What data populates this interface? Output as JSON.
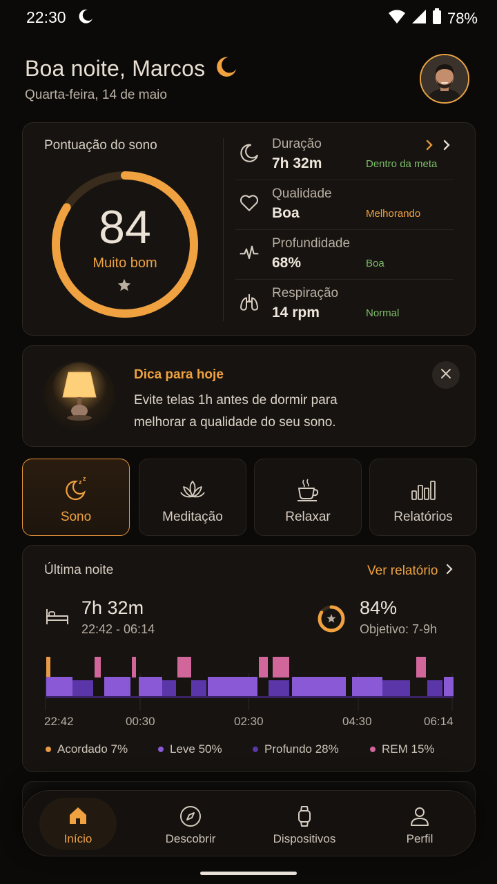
{
  "status_bar": {
    "time": "22:30",
    "battery": "78%"
  },
  "header": {
    "greeting": "Boa noite, Marcos",
    "date": "Quarta-feira, 14 de maio"
  },
  "score": {
    "title": "Pontuação do sono",
    "value": "84",
    "value_fraction": 0.84,
    "label": "Muito bom",
    "metrics": [
      {
        "label": "Duração",
        "value": "7h 32m",
        "status": "Dentro da meta",
        "status_color": "#7fbf6a",
        "icon": "moon-icon"
      },
      {
        "label": "Qualidade",
        "value": "Boa",
        "status": "Melhorando",
        "status_color": "#f0a241",
        "icon": "heart-icon"
      },
      {
        "label": "Profundidade",
        "value": "68%",
        "status": "Boa",
        "status_color": "#7fbf6a",
        "icon": "pulse-icon"
      },
      {
        "label": "Respiração",
        "value": "14 rpm",
        "status": "Normal",
        "status_color": "#7fbf6a",
        "icon": "lungs-icon"
      }
    ]
  },
  "tip": {
    "title": "Dica para hoje",
    "text": "Evite telas 1h antes de dormir para melhorar a qualidade do seu sono."
  },
  "tabs": [
    {
      "label": "Sono",
      "icon": "sleep-moon-icon",
      "active": true
    },
    {
      "label": "Meditação",
      "icon": "lotus-icon",
      "active": false
    },
    {
      "label": "Relaxar",
      "icon": "coffee-cup-icon",
      "active": false
    },
    {
      "label": "Relatórios",
      "icon": "bar-chart-icon",
      "active": false
    }
  ],
  "last_night": {
    "title": "Última noite",
    "link": "Ver relatório",
    "duration": "7h 32m",
    "range": "22:42 - 06:14",
    "percent": "84%",
    "percent_fraction": 0.84,
    "goal": "Objetivo: 7-9h",
    "ticks": [
      "22:42",
      "00:30",
      "02:30",
      "04:30",
      "06:14"
    ],
    "legend": [
      {
        "label": "Acordado 7%",
        "color": "#e89a45"
      },
      {
        "label": "Leve 50%",
        "color": "#8a5ad6"
      },
      {
        "label": "Profundo 28%",
        "color": "#5b36a8"
      },
      {
        "label": "REM 15%",
        "color": "#d0669a"
      }
    ]
  },
  "nav": [
    {
      "label": "Início",
      "icon": "home-icon",
      "active": true
    },
    {
      "label": "Descobrir",
      "icon": "compass-icon",
      "active": false
    },
    {
      "label": "Dispositivos",
      "icon": "watch-icon",
      "active": false
    },
    {
      "label": "Perfil",
      "icon": "person-icon",
      "active": false
    }
  ]
}
